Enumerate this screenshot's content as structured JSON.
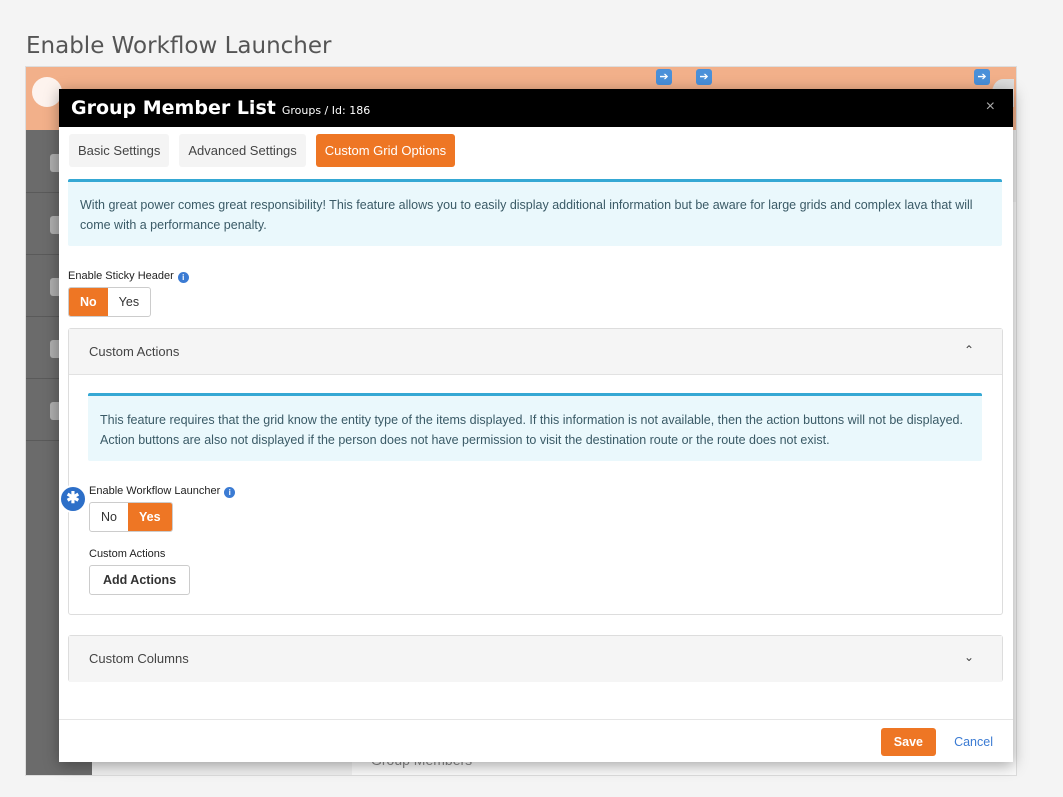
{
  "page_heading": "Enable Workflow Launcher",
  "background": {
    "section_text": "Group Members",
    "nav_arrows": [
      "➔",
      "➔",
      "➔"
    ]
  },
  "modal": {
    "title": "Group Member List",
    "subtitle": "Groups / Id: 186",
    "close_glyph": "×",
    "tabs": [
      {
        "label": "Basic Settings"
      },
      {
        "label": "Advanced Settings"
      },
      {
        "label": "Custom Grid Options"
      }
    ],
    "intro_alert": "With great power comes great responsibility! This feature allows you to easily display additional information but be aware for large grids and complex lava that will come with a performance penalty.",
    "sticky_header": {
      "label": "Enable Sticky Header",
      "info": "i",
      "options": [
        "No",
        "Yes"
      ],
      "selected": "No"
    },
    "custom_actions_panel": {
      "title": "Custom Actions",
      "chevron": "⌃",
      "alert": "This feature requires that the grid know the entity type of the items displayed. If this information is not available, then the action buttons will not be displayed. Action buttons are also not displayed if the person does not have permission to visit the destination route or the route does not exist.",
      "workflow_launcher": {
        "label": "Enable Workflow Launcher",
        "info": "i",
        "options": [
          "No",
          "Yes"
        ],
        "selected": "Yes"
      },
      "custom_actions_label": "Custom Actions",
      "add_actions_label": "Add Actions"
    },
    "custom_columns_panel": {
      "title": "Custom Columns",
      "chevron": "⌄"
    },
    "footer": {
      "save_label": "Save",
      "cancel_label": "Cancel"
    }
  },
  "callout_badge": "✱",
  "colors": {
    "accent": "#ee7624",
    "topbar": "#f2b08a",
    "link": "#3b7bd3",
    "alert_border": "#35a8d4"
  }
}
